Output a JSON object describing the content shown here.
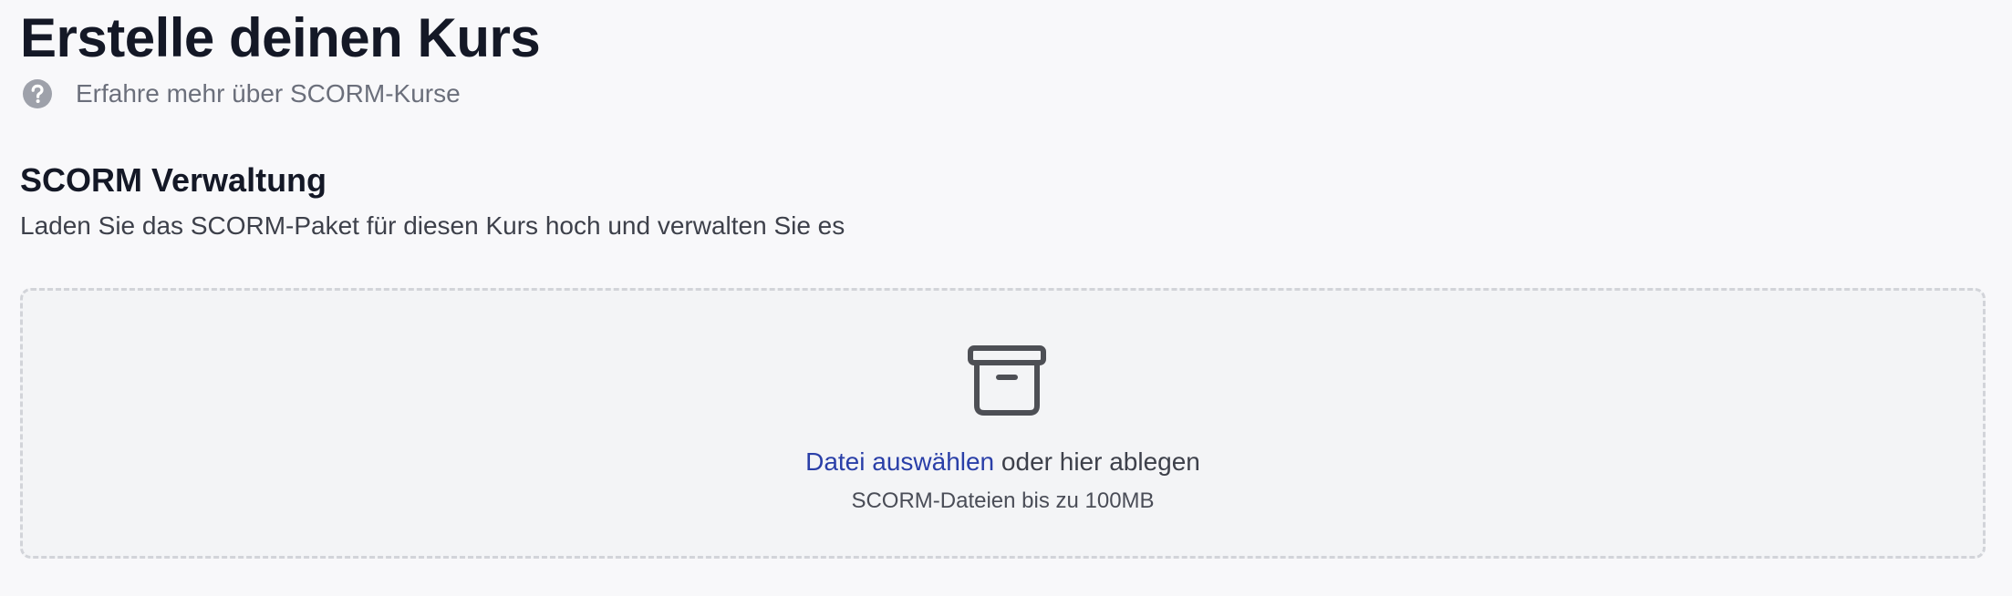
{
  "header": {
    "title": "Erstelle deinen Kurs",
    "help_link_label": "Erfahre mehr über SCORM-Kurse",
    "help_icon": "question-circle-icon"
  },
  "section": {
    "title": "SCORM Verwaltung",
    "description": "Laden Sie das SCORM-Paket für diesen Kurs hoch und verwalten Sie es"
  },
  "upload": {
    "icon": "archive-box-icon",
    "choose_file_label": "Datei auswählen",
    "drop_text": " oder hier ablegen",
    "hint": "SCORM-Dateien bis zu 100MB"
  },
  "colors": {
    "background": "#f8f8fa",
    "link": "#2a3fa8",
    "dropzone_border": "#d2d4d9",
    "dropzone_bg": "#f3f4f6"
  }
}
